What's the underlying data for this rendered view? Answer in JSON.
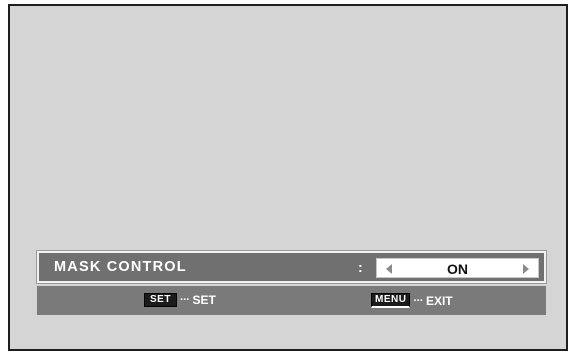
{
  "menu": {
    "item_label": "MASK CONTROL",
    "separator": ":",
    "value": "ON"
  },
  "guide": {
    "set_key": "SET",
    "set_dots": "···",
    "set_label": "SET",
    "exit_key": "MENU",
    "exit_dots": "···",
    "exit_label": "EXIT"
  },
  "icons": {
    "left": "left-arrow-icon",
    "right": "right-arrow-icon"
  },
  "colors": {
    "screen_bg": "#d5d5d5",
    "menu_bar": "#707070",
    "guide_bar": "#7a7a7a",
    "value_box": "#ffffff"
  }
}
